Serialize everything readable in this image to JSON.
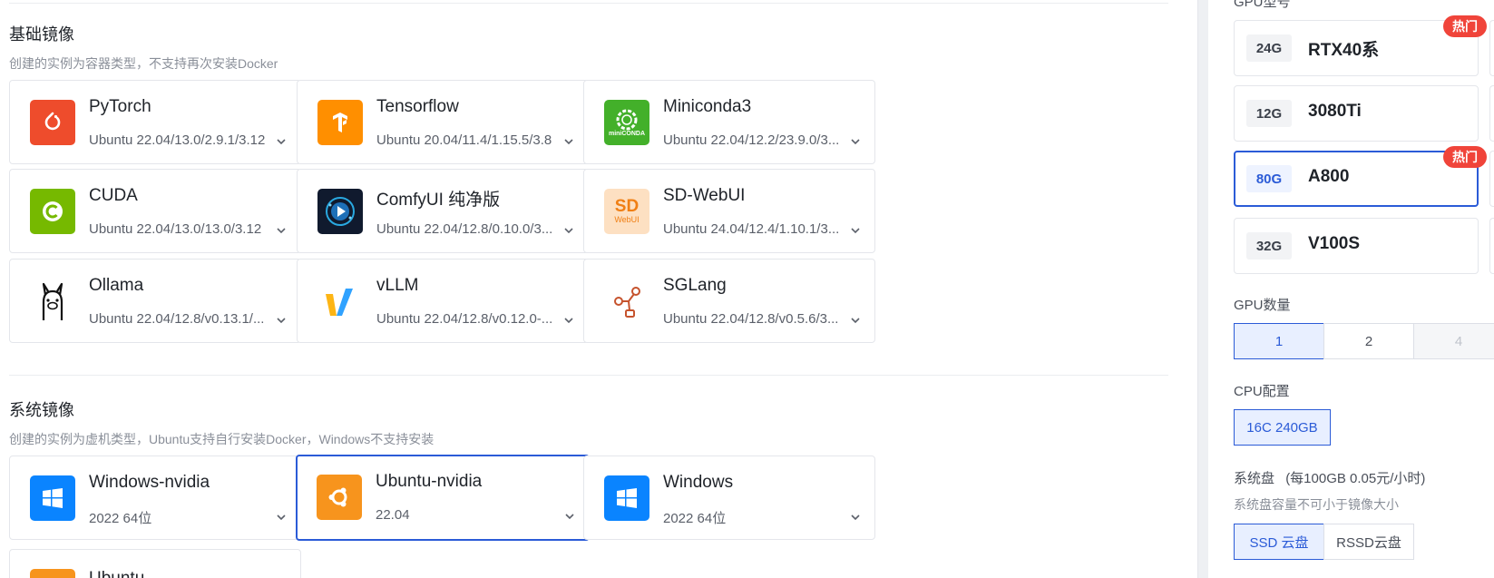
{
  "base_section": {
    "title": "基础镜像",
    "subtitle": "创建的实例为容器类型，不支持再次安装Docker",
    "cards": [
      {
        "name": "PyTorch",
        "version": "Ubuntu 22.04/13.0/2.9.1/3.12",
        "icon": "pytorch-logo"
      },
      {
        "name": "Tensorflow",
        "version": "Ubuntu 20.04/11.4/1.15.5/3.8",
        "icon": "tensorflow-logo"
      },
      {
        "name": "Miniconda3",
        "version": "Ubuntu 22.04/12.2/23.9.0/3...",
        "icon": "miniconda-logo",
        "logo_text": "miniCONDA"
      },
      {
        "name": "CUDA",
        "version": "Ubuntu 22.04/13.0/13.0/3.12",
        "icon": "cuda-logo"
      },
      {
        "name": "ComfyUI 纯净版",
        "version": "Ubuntu 22.04/12.8/0.10.0/3...",
        "icon": "comfyui-logo"
      },
      {
        "name": "SD-WebUI",
        "version": "Ubuntu 24.04/12.4/1.10.1/3...",
        "icon": "sd-webui-logo",
        "logo_text_main": "SD",
        "logo_text_sub": "WebUI"
      },
      {
        "name": "Ollama",
        "version": "Ubuntu 22.04/12.8/v0.13.1/...",
        "icon": "ollama-logo"
      },
      {
        "name": "vLLM",
        "version": "Ubuntu 22.04/12.8/v0.12.0-...",
        "icon": "vllm-logo"
      },
      {
        "name": "SGLang",
        "version": "Ubuntu 22.04/12.8/v0.5.6/3...",
        "icon": "sglang-logo"
      }
    ]
  },
  "system_section": {
    "title": "系统镜像",
    "subtitle": "创建的实例为虚机类型，Ubuntu支持自行安装Docker，Windows不支持安装",
    "cards": [
      {
        "name": "Windows-nvidia",
        "version": "2022 64位",
        "icon": "windows-logo"
      },
      {
        "name": "Ubuntu-nvidia",
        "version": "22.04",
        "icon": "ubuntu-logo",
        "selected": true
      },
      {
        "name": "Windows",
        "version": "2022 64位",
        "icon": "windows-logo"
      },
      {
        "name": "Ubuntu",
        "version": "",
        "icon": "ubuntu-logo"
      }
    ]
  },
  "right_panel": {
    "gpu_model_label": "GPU型号",
    "gpus": [
      {
        "memory": "24G",
        "name": "RTX40系",
        "hot": "热门"
      },
      {
        "memory": "12G",
        "name": "3080Ti",
        "hot": ""
      },
      {
        "memory": "80G",
        "name": "A800",
        "hot": "热门",
        "selected": true
      },
      {
        "memory": "32G",
        "name": "V100S",
        "hot": ""
      }
    ],
    "gpu_count_label": "GPU数量",
    "gpu_counts": [
      "1",
      "2",
      "4"
    ],
    "cpu_label": "CPU配置",
    "cpu_option": "16C 240GB",
    "disk_label": "系统盘",
    "disk_price": "(每100GB 0.05元/小时)",
    "disk_note": "系统盘容量不可小于镜像大小",
    "disk_types": [
      "SSD 云盘",
      "RSSD云盘"
    ]
  },
  "colors": {
    "accent": "#2b5bd7",
    "hot": "#f0443a",
    "pytorch": "#ee4c2c",
    "tensorflow": "#ff8f00",
    "miniconda": "#43b02a",
    "cuda": "#76b900",
    "windows": "#0a84ff",
    "ubuntu": "#f7941d"
  }
}
